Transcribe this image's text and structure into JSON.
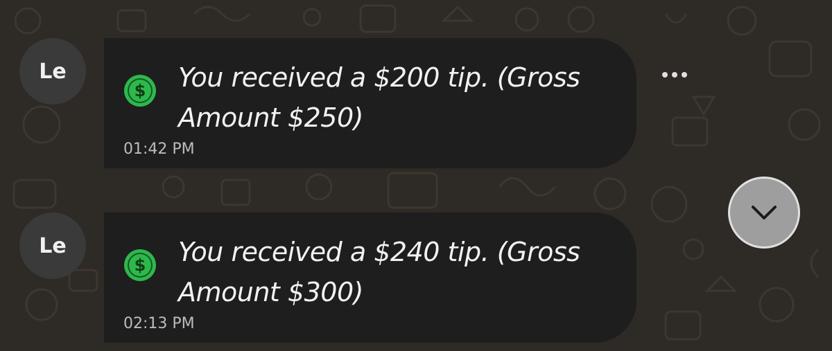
{
  "colors": {
    "background": "#2e2a25",
    "bubble": "#1e1e1e",
    "coin_green": "#2eb84c",
    "coin_dark": "#0f5a22",
    "text": "#f2f2f2",
    "timestamp": "#bdbdbd",
    "scroll_button": "#9e9e9e"
  },
  "messages": [
    {
      "sender_initials": "Le",
      "icon": "dollar-coin-icon",
      "text": "You received a $200 tip. (Gross Amount $250)",
      "time": "01:42 PM"
    },
    {
      "sender_initials": "Le",
      "icon": "dollar-coin-icon",
      "text": "You received a $240 tip. (Gross Amount $300)",
      "time": "02:13 PM"
    }
  ],
  "controls": {
    "more_options_icon": "more-horizontal-icon",
    "scroll_down_icon": "chevron-down-icon"
  }
}
